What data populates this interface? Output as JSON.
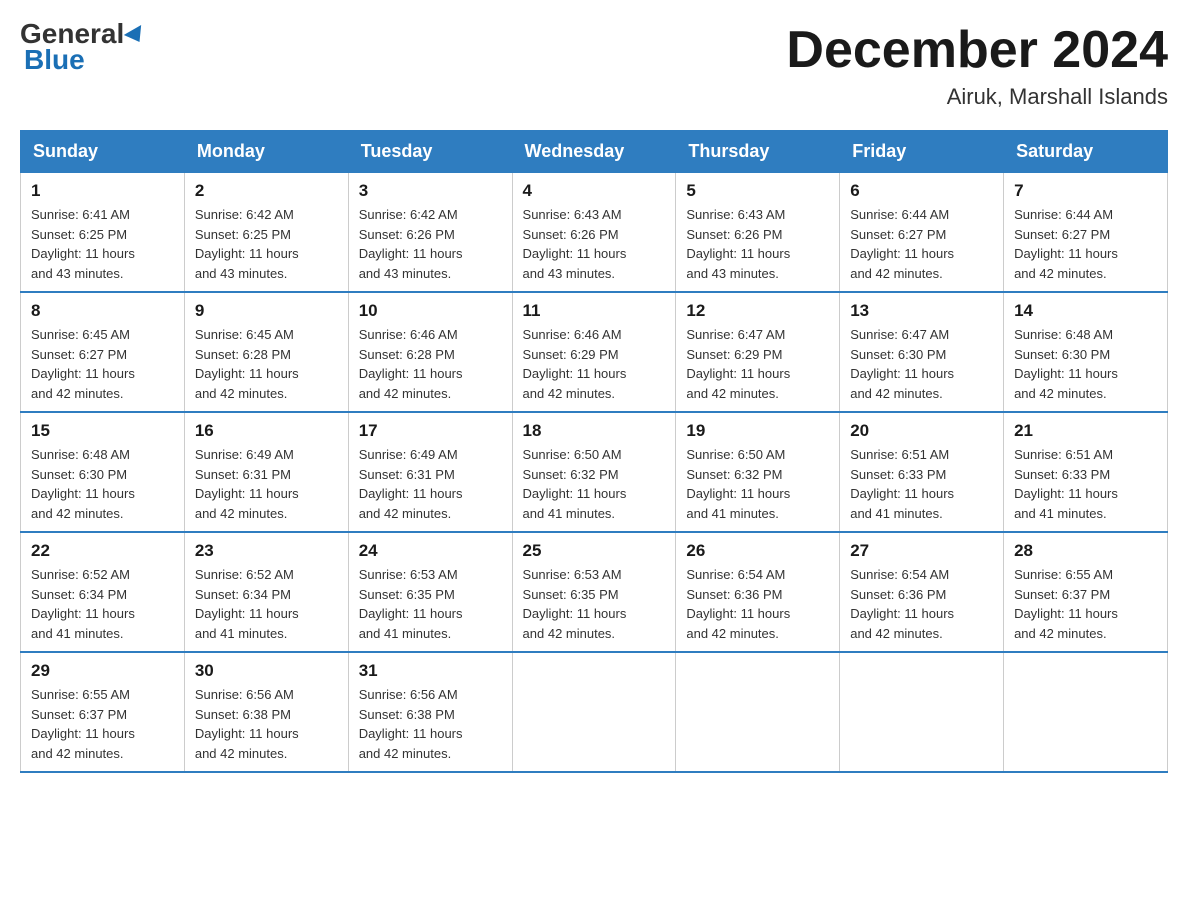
{
  "header": {
    "logo_general": "General",
    "logo_blue": "Blue",
    "month_title": "December 2024",
    "location": "Airuk, Marshall Islands"
  },
  "days_of_week": [
    "Sunday",
    "Monday",
    "Tuesday",
    "Wednesday",
    "Thursday",
    "Friday",
    "Saturday"
  ],
  "weeks": [
    [
      {
        "day": "1",
        "sunrise": "6:41 AM",
        "sunset": "6:25 PM",
        "daylight": "11 hours and 43 minutes."
      },
      {
        "day": "2",
        "sunrise": "6:42 AM",
        "sunset": "6:25 PM",
        "daylight": "11 hours and 43 minutes."
      },
      {
        "day": "3",
        "sunrise": "6:42 AM",
        "sunset": "6:26 PM",
        "daylight": "11 hours and 43 minutes."
      },
      {
        "day": "4",
        "sunrise": "6:43 AM",
        "sunset": "6:26 PM",
        "daylight": "11 hours and 43 minutes."
      },
      {
        "day": "5",
        "sunrise": "6:43 AM",
        "sunset": "6:26 PM",
        "daylight": "11 hours and 43 minutes."
      },
      {
        "day": "6",
        "sunrise": "6:44 AM",
        "sunset": "6:27 PM",
        "daylight": "11 hours and 42 minutes."
      },
      {
        "day": "7",
        "sunrise": "6:44 AM",
        "sunset": "6:27 PM",
        "daylight": "11 hours and 42 minutes."
      }
    ],
    [
      {
        "day": "8",
        "sunrise": "6:45 AM",
        "sunset": "6:27 PM",
        "daylight": "11 hours and 42 minutes."
      },
      {
        "day": "9",
        "sunrise": "6:45 AM",
        "sunset": "6:28 PM",
        "daylight": "11 hours and 42 minutes."
      },
      {
        "day": "10",
        "sunrise": "6:46 AM",
        "sunset": "6:28 PM",
        "daylight": "11 hours and 42 minutes."
      },
      {
        "day": "11",
        "sunrise": "6:46 AM",
        "sunset": "6:29 PM",
        "daylight": "11 hours and 42 minutes."
      },
      {
        "day": "12",
        "sunrise": "6:47 AM",
        "sunset": "6:29 PM",
        "daylight": "11 hours and 42 minutes."
      },
      {
        "day": "13",
        "sunrise": "6:47 AM",
        "sunset": "6:30 PM",
        "daylight": "11 hours and 42 minutes."
      },
      {
        "day": "14",
        "sunrise": "6:48 AM",
        "sunset": "6:30 PM",
        "daylight": "11 hours and 42 minutes."
      }
    ],
    [
      {
        "day": "15",
        "sunrise": "6:48 AM",
        "sunset": "6:30 PM",
        "daylight": "11 hours and 42 minutes."
      },
      {
        "day": "16",
        "sunrise": "6:49 AM",
        "sunset": "6:31 PM",
        "daylight": "11 hours and 42 minutes."
      },
      {
        "day": "17",
        "sunrise": "6:49 AM",
        "sunset": "6:31 PM",
        "daylight": "11 hours and 42 minutes."
      },
      {
        "day": "18",
        "sunrise": "6:50 AM",
        "sunset": "6:32 PM",
        "daylight": "11 hours and 41 minutes."
      },
      {
        "day": "19",
        "sunrise": "6:50 AM",
        "sunset": "6:32 PM",
        "daylight": "11 hours and 41 minutes."
      },
      {
        "day": "20",
        "sunrise": "6:51 AM",
        "sunset": "6:33 PM",
        "daylight": "11 hours and 41 minutes."
      },
      {
        "day": "21",
        "sunrise": "6:51 AM",
        "sunset": "6:33 PM",
        "daylight": "11 hours and 41 minutes."
      }
    ],
    [
      {
        "day": "22",
        "sunrise": "6:52 AM",
        "sunset": "6:34 PM",
        "daylight": "11 hours and 41 minutes."
      },
      {
        "day": "23",
        "sunrise": "6:52 AM",
        "sunset": "6:34 PM",
        "daylight": "11 hours and 41 minutes."
      },
      {
        "day": "24",
        "sunrise": "6:53 AM",
        "sunset": "6:35 PM",
        "daylight": "11 hours and 41 minutes."
      },
      {
        "day": "25",
        "sunrise": "6:53 AM",
        "sunset": "6:35 PM",
        "daylight": "11 hours and 42 minutes."
      },
      {
        "day": "26",
        "sunrise": "6:54 AM",
        "sunset": "6:36 PM",
        "daylight": "11 hours and 42 minutes."
      },
      {
        "day": "27",
        "sunrise": "6:54 AM",
        "sunset": "6:36 PM",
        "daylight": "11 hours and 42 minutes."
      },
      {
        "day": "28",
        "sunrise": "6:55 AM",
        "sunset": "6:37 PM",
        "daylight": "11 hours and 42 minutes."
      }
    ],
    [
      {
        "day": "29",
        "sunrise": "6:55 AM",
        "sunset": "6:37 PM",
        "daylight": "11 hours and 42 minutes."
      },
      {
        "day": "30",
        "sunrise": "6:56 AM",
        "sunset": "6:38 PM",
        "daylight": "11 hours and 42 minutes."
      },
      {
        "day": "31",
        "sunrise": "6:56 AM",
        "sunset": "6:38 PM",
        "daylight": "11 hours and 42 minutes."
      },
      null,
      null,
      null,
      null
    ]
  ],
  "labels": {
    "sunrise": "Sunrise:",
    "sunset": "Sunset:",
    "daylight": "Daylight:"
  }
}
